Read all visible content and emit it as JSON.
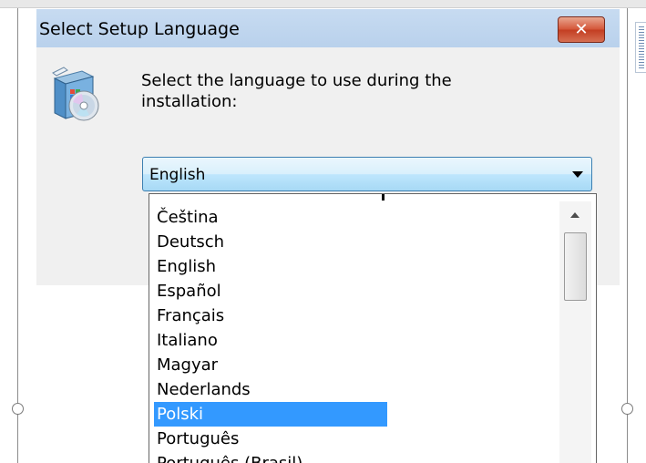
{
  "dialog": {
    "title": "Select Setup Language",
    "close_label": "✕",
    "prompt": "Select the language to use during the installation:",
    "icon": "setup-cd-icon"
  },
  "combo": {
    "selected": "English"
  },
  "dropdown": {
    "items": [
      {
        "label": "Čeština",
        "selected": false
      },
      {
        "label": "Deutsch",
        "selected": false
      },
      {
        "label": "English",
        "selected": false
      },
      {
        "label": "Español",
        "selected": false
      },
      {
        "label": "Français",
        "selected": false
      },
      {
        "label": "Italiano",
        "selected": false
      },
      {
        "label": "Magyar",
        "selected": false
      },
      {
        "label": "Nederlands",
        "selected": false
      },
      {
        "label": "Polski",
        "selected": true
      },
      {
        "label": "Português",
        "selected": false
      },
      {
        "label": "Português (Brasil)",
        "selected": false
      }
    ]
  },
  "colors": {
    "titlebar": "#b9d1ec",
    "selection": "#3399ff",
    "close_button": "#c33e22"
  }
}
